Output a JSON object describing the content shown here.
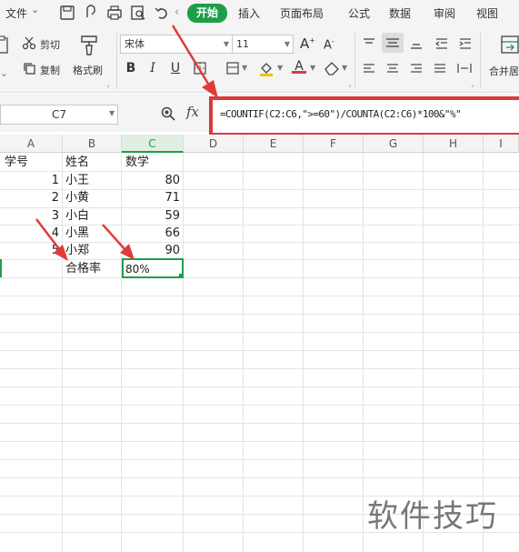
{
  "menu": {
    "file": "文件",
    "home": "开始",
    "insert": "插入",
    "page_layout": "页面布局",
    "formulas": "公式",
    "data": "数据",
    "review": "审阅",
    "view": "视图"
  },
  "ribbon": {
    "cut": "剪切",
    "copy": "复制",
    "format_painter": "格式刷",
    "font_name": "宋体",
    "font_size": "11",
    "merge": "合并居"
  },
  "formula_bar": {
    "cell_ref": "C7",
    "fx": "fx",
    "formula": "=COUNTIF(C2:C6,\">=60\")/COUNTA(C2:C6)*100&\"%\""
  },
  "sheet": {
    "columns": [
      "A",
      "B",
      "C",
      "D",
      "E",
      "F",
      "G",
      "H",
      "I"
    ],
    "headers": [
      "学号",
      "姓名",
      "数学"
    ],
    "rows": [
      {
        "id": "1",
        "name": "小王",
        "score": "80"
      },
      {
        "id": "2",
        "name": "小黄",
        "score": "71"
      },
      {
        "id": "3",
        "name": "小白",
        "score": "59"
      },
      {
        "id": "4",
        "name": "小黑",
        "score": "66"
      },
      {
        "id": "5",
        "name": "小郑",
        "score": "90"
      }
    ],
    "pass_label": "合格率",
    "pass_value": "80%"
  },
  "watermark": "软件技巧",
  "colors": {
    "accent_green": "#1f9e4a",
    "highlight_red": "#d93a3a"
  }
}
